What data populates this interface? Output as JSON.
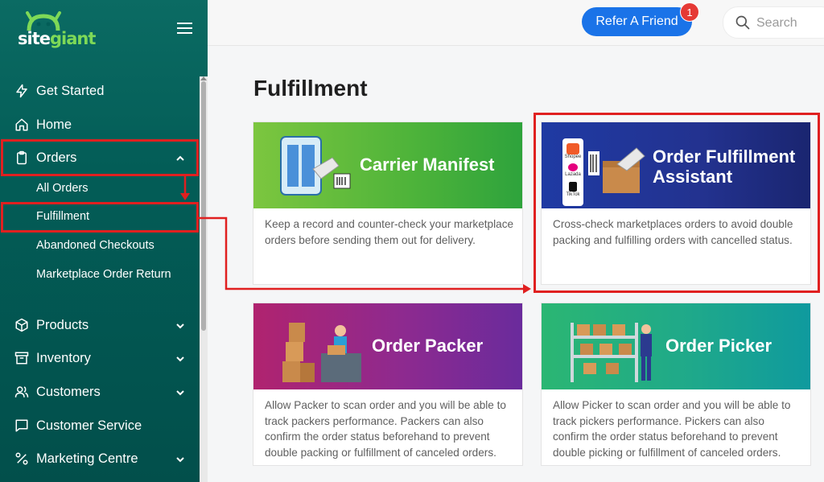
{
  "app": {
    "logo_site": "site",
    "logo_giant": "giant"
  },
  "sidebar": {
    "items": [
      {
        "label": "Get Started",
        "icon": "bolt-icon"
      },
      {
        "label": "Home",
        "icon": "home-icon"
      },
      {
        "label": "Orders",
        "icon": "clipboard-icon",
        "expanded": true
      },
      {
        "label": "Products",
        "icon": "box-icon"
      },
      {
        "label": "Inventory",
        "icon": "archive-icon"
      },
      {
        "label": "Customers",
        "icon": "users-icon"
      },
      {
        "label": "Customer Service",
        "icon": "chat-icon"
      },
      {
        "label": "Marketing Centre",
        "icon": "percent-icon"
      }
    ],
    "orders_sub": [
      {
        "label": "All Orders"
      },
      {
        "label": "Fulfillment",
        "active": true
      },
      {
        "label": "Abandoned Checkouts"
      },
      {
        "label": "Marketplace Order Return"
      }
    ]
  },
  "header": {
    "refer_label": "Refer A Friend",
    "notification_count": "1",
    "search_placeholder": "Search"
  },
  "main": {
    "title": "Fulfillment",
    "cards": [
      {
        "title": "Carrier Manifest",
        "description": "Keep a record and counter-check your marketplace orders before sending them out for delivery."
      },
      {
        "title_line1": "Order Fulfillment",
        "title_line2": "Assistant",
        "description": "Cross-check marketplaces orders to avoid double packing and fulfilling orders with cancelled status.",
        "logos": [
          "Shopee",
          "Lazada",
          "TikTok"
        ]
      },
      {
        "title": "Order Packer",
        "description": "Allow Packer to scan order and you will be able to track packers performance. Packers can also confirm the order status beforehand to prevent double packing or fulfillment of canceled orders."
      },
      {
        "title": "Order Picker",
        "description": "Allow Picker to scan order and you will be able to track pickers performance. Pickers can also confirm the order status beforehand to prevent double picking or fulfillment of canceled orders."
      }
    ]
  },
  "colors": {
    "sidebar": "#035d57",
    "accent": "#1a73e8",
    "highlight": "#e02020"
  }
}
